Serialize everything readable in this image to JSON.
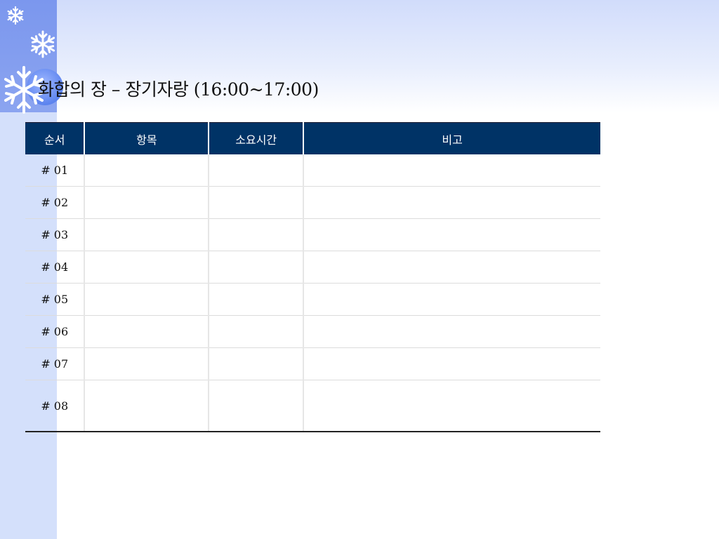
{
  "title": "화합의 장 – 장기자랑 (16:00~17:00)",
  "table": {
    "headers": [
      "순서",
      "항목",
      "소요시간",
      "비고"
    ],
    "rows": [
      {
        "order": "# 01",
        "item": "",
        "time": "",
        "note": ""
      },
      {
        "order": "# 02",
        "item": "",
        "time": "",
        "note": ""
      },
      {
        "order": "# 03",
        "item": "",
        "time": "",
        "note": ""
      },
      {
        "order": "# 04",
        "item": "",
        "time": "",
        "note": ""
      },
      {
        "order": "# 05",
        "item": "",
        "time": "",
        "note": ""
      },
      {
        "order": "# 06",
        "item": "",
        "time": "",
        "note": ""
      },
      {
        "order": "# 07",
        "item": "",
        "time": "",
        "note": ""
      },
      {
        "order": "# 08",
        "item": "",
        "time": "",
        "note": ""
      }
    ]
  },
  "colors": {
    "header_bg": "#003366",
    "accent_band": "#7b97ee",
    "side_band": "#d4e0fb"
  },
  "decorations": [
    "snowflake-icon",
    "snowflake-icon",
    "snowflake-icon"
  ]
}
